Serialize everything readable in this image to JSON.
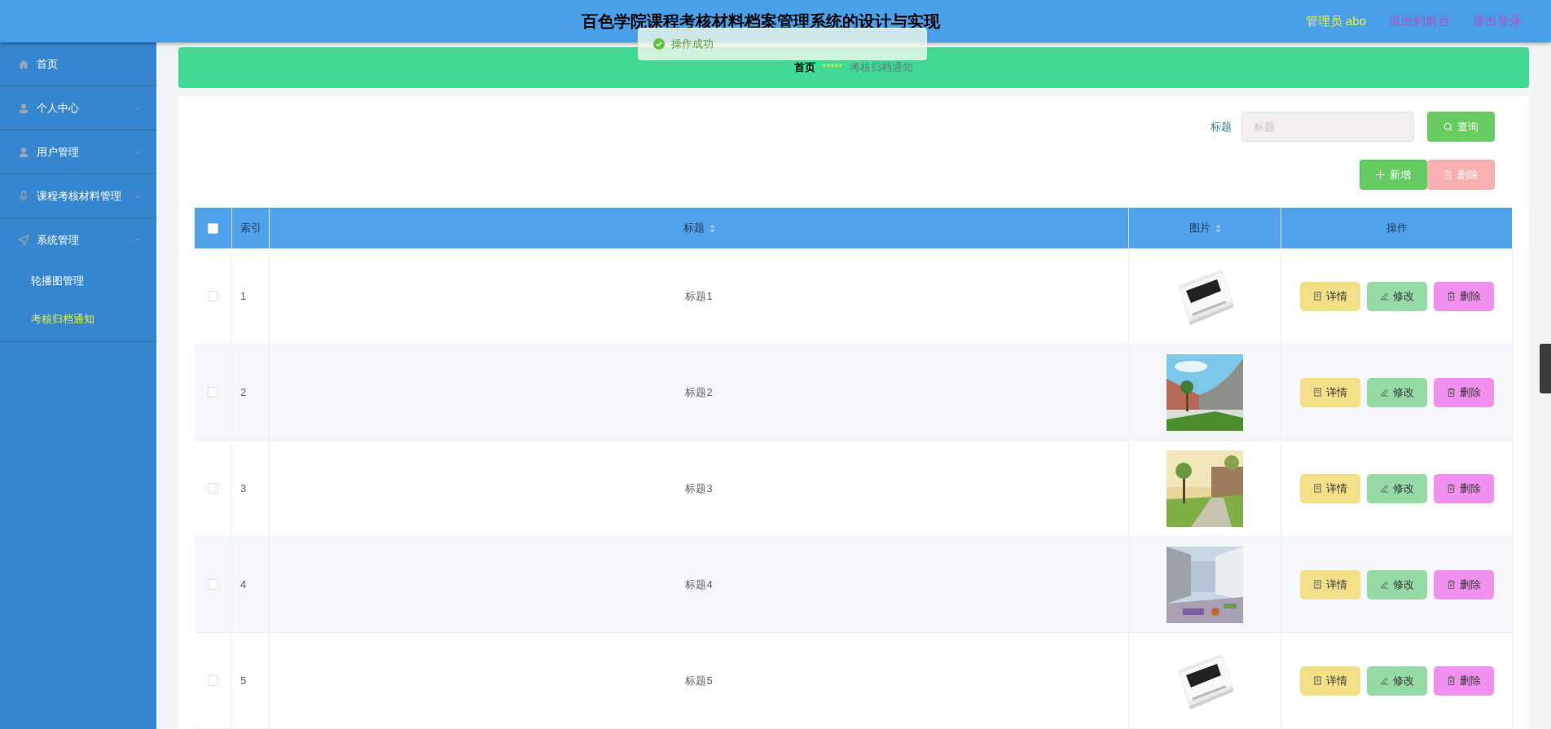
{
  "header": {
    "title": "百色学院课程考核材料档案管理系统的设计与实现",
    "user": "管理员 abo",
    "links": [
      "退出到前台",
      "退出登录"
    ]
  },
  "toast": {
    "message": "操作成功"
  },
  "sidebar": {
    "items": [
      {
        "label": "首页",
        "kind": "link"
      },
      {
        "label": "个人中心",
        "kind": "menu",
        "expanded": false
      },
      {
        "label": "用户管理",
        "kind": "menu",
        "expanded": false
      },
      {
        "label": "课程考核材料管理",
        "kind": "menu",
        "expanded": false
      },
      {
        "label": "系统管理",
        "kind": "menu",
        "expanded": true,
        "children": [
          {
            "label": "轮播图管理",
            "selected": false
          },
          {
            "label": "考核归档通知",
            "selected": true
          }
        ]
      }
    ]
  },
  "breadcrumb": {
    "home": "首页",
    "separator": "*****",
    "current": "考核归档通知"
  },
  "search": {
    "label": "标题",
    "placeholder": "标题",
    "button": "查询"
  },
  "actions": [
    {
      "label": "新增",
      "kind": "add",
      "disabled": false
    },
    {
      "label": "删除",
      "kind": "delete",
      "disabled": true
    }
  ],
  "table": {
    "header_checked": false,
    "columns": [
      {
        "label": "索引",
        "sortable": false
      },
      {
        "label": "标题",
        "sortable": true
      },
      {
        "label": "图片",
        "sortable": true
      },
      {
        "label": "操作",
        "sortable": false
      }
    ],
    "rows": [
      {
        "index": "1",
        "title": "标题1",
        "checked": false,
        "picture": {
          "kind": "picture"
        },
        "actions": [
          "详情",
          "修改",
          "删除"
        ]
      },
      {
        "index": "2",
        "title": "标题2",
        "checked": false,
        "picture": {
          "kind": "picture"
        },
        "actions": [
          "详情",
          "修改",
          "删除"
        ]
      },
      {
        "index": "3",
        "title": "标题3",
        "checked": false,
        "picture": {
          "kind": "picture"
        },
        "actions": [
          "详情",
          "修改",
          "删除"
        ]
      },
      {
        "index": "4",
        "title": "标题4",
        "checked": false,
        "picture": {
          "kind": "picture"
        },
        "actions": [
          "详情",
          "修改",
          "删除"
        ]
      },
      {
        "index": "5",
        "title": "标题5",
        "checked": false,
        "picture": {
          "kind": "picture"
        },
        "actions": [
          "详情",
          "修改",
          "删除"
        ]
      }
    ]
  }
}
